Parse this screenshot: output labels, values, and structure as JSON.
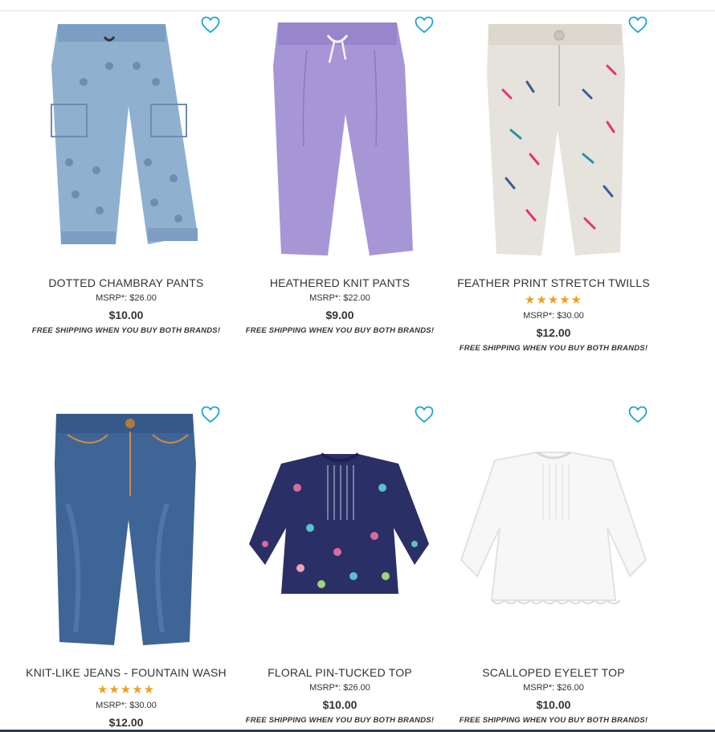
{
  "products": [
    {
      "name": "DOTTED CHAMBRAY PANTS",
      "msrp": "MSRP*: $26.00",
      "price": "$10.00",
      "shipping": "FREE SHIPPING WHEN YOU BUY BOTH BRANDS!",
      "rating": 0,
      "image": "dotted-chambray-pants-image",
      "colors": {
        "main": "#8fb0cf",
        "accent": "#5f7fa6"
      }
    },
    {
      "name": "HEATHERED KNIT PANTS",
      "msrp": "MSRP*: $22.00",
      "price": "$9.00",
      "shipping": "FREE SHIPPING WHEN YOU BUY BOTH BRANDS!",
      "rating": 0,
      "image": "heathered-knit-pants-image",
      "colors": {
        "main": "#a796d6",
        "accent": "#8a78c3"
      }
    },
    {
      "name": "FEATHER PRINT STRETCH TWILLS",
      "stars": "★★★★★",
      "rating": 5,
      "msrp": "MSRP*: $30.00",
      "price": "$12.00",
      "shipping": "FREE SHIPPING WHEN YOU BUY BOTH BRANDS!",
      "image": "feather-print-twills-image",
      "colors": {
        "main": "#e6e3dc",
        "accent": "#c9c4b8"
      }
    },
    {
      "name": "KNIT-LIKE JEANS - FOUNTAIN WASH",
      "stars": "★★★★★",
      "rating": 5,
      "msrp": "MSRP*: $30.00",
      "price": "$12.00",
      "image": "knit-like-jeans-image",
      "colors": {
        "main": "#3f6596",
        "accent": "#2b4a72"
      }
    },
    {
      "name": "FLORAL PIN-TUCKED TOP",
      "msrp": "MSRP*: $26.00",
      "price": "$10.00",
      "shipping": "FREE SHIPPING WHEN YOU BUY BOTH BRANDS!",
      "rating": 0,
      "image": "floral-top-image",
      "colors": {
        "main": "#2a2f66",
        "accent": "#d76ba0"
      }
    },
    {
      "name": "SCALLOPED EYELET TOP",
      "msrp": "MSRP*: $26.00",
      "price": "$10.00",
      "shipping": "FREE SHIPPING WHEN YOU BUY BOTH BRANDS!",
      "rating": 0,
      "image": "eyelet-top-image",
      "colors": {
        "main": "#f7f7f7",
        "accent": "#dcdcdc"
      }
    }
  ],
  "colors": {
    "heart": "#1aa3d6",
    "star": "#f0a019",
    "text": "#333333"
  },
  "icons": {
    "favorite": "heart-outline-icon",
    "rating": "star-icon"
  }
}
